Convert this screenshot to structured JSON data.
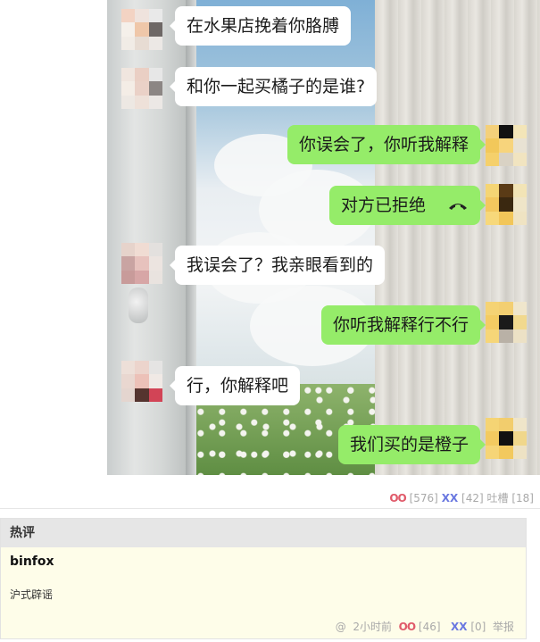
{
  "chat": {
    "messages": [
      {
        "side": "left",
        "text": "在水果店挽着你胳膊"
      },
      {
        "side": "left",
        "text": "和你一起买橘子的是谁?"
      },
      {
        "side": "right",
        "text": "你误会了，你听我解释"
      },
      {
        "side": "right",
        "text": "对方已拒绝",
        "icon": "hang-up-phone-icon"
      },
      {
        "side": "left",
        "text": "我误会了？我亲眼看到的"
      },
      {
        "side": "right",
        "text": "你听我解释行不行"
      },
      {
        "side": "left",
        "text": "行，你解释吧"
      },
      {
        "side": "right",
        "text": "我们买的是橙子"
      }
    ],
    "colors": {
      "my_bubble": "#95ec69",
      "their_bubble": "#ffffff"
    }
  },
  "post_stats": {
    "oo_label": "OO",
    "oo_count": "[576]",
    "xx_label": "XX",
    "xx_count": "[42]",
    "tucao_label": "吐槽",
    "tucao_count": "[18]"
  },
  "hot_comments": {
    "title": "热评",
    "items": [
      {
        "author": "binfox",
        "text": "沪式辟谣",
        "at": "@",
        "time": "2小时前",
        "oo_label": "OO",
        "oo_count": "[46]",
        "xx_label": "XX",
        "xx_count": "[0]",
        "report_label": "举报"
      }
    ]
  }
}
